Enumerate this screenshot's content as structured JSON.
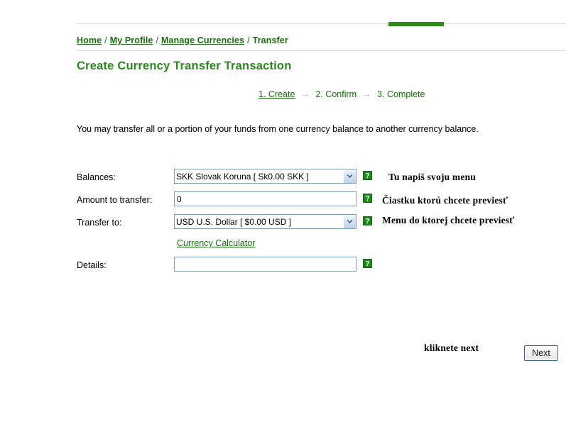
{
  "topbar": {
    "tab_color": "#2e8b18"
  },
  "breadcrumb": {
    "items": [
      {
        "label": "Home",
        "link": true
      },
      {
        "label": "My Profile",
        "link": true
      },
      {
        "label": "Manage Currencies",
        "link": true
      },
      {
        "label": "Transfer",
        "link": false
      }
    ],
    "separator": "/"
  },
  "page": {
    "title": "Create Currency Transfer Transaction",
    "intro": "You may transfer all or a portion of your funds from one currency balance to another currency balance.",
    "title_color": "#2b8a1e"
  },
  "steps": {
    "arrow": "→",
    "items": [
      {
        "label": "1. Create",
        "active": true
      },
      {
        "label": "2. Confirm",
        "active": false
      },
      {
        "label": "3. Complete",
        "active": false
      }
    ]
  },
  "form": {
    "balances": {
      "label": "Balances:",
      "value": "SKK Slovak Koruna [ Sk0.00 SKK ]",
      "options": [
        "SKK Slovak Koruna [ Sk0.00 SKK ]"
      ],
      "help": "?"
    },
    "amount": {
      "label": "Amount to transfer:",
      "value": "0",
      "placeholder": "",
      "help": "?"
    },
    "transfer_to": {
      "label": "Transfer to:",
      "value": "USD U.S. Dollar [ $0.00 USD ]",
      "options": [
        "USD U.S. Dollar [ $0.00 USD ]"
      ],
      "help": "?"
    },
    "calculator_link": "Currency Calculator",
    "details": {
      "label": "Details:",
      "value": "",
      "placeholder": "",
      "help": "?"
    }
  },
  "annotations": {
    "balances": "Tu napiš svoju menu",
    "amount": "Čiastku ktorú chcete previesť",
    "transfer_to": "Menu do ktorej chcete previesť",
    "next": "kliknete next"
  },
  "buttons": {
    "next": "Next"
  }
}
